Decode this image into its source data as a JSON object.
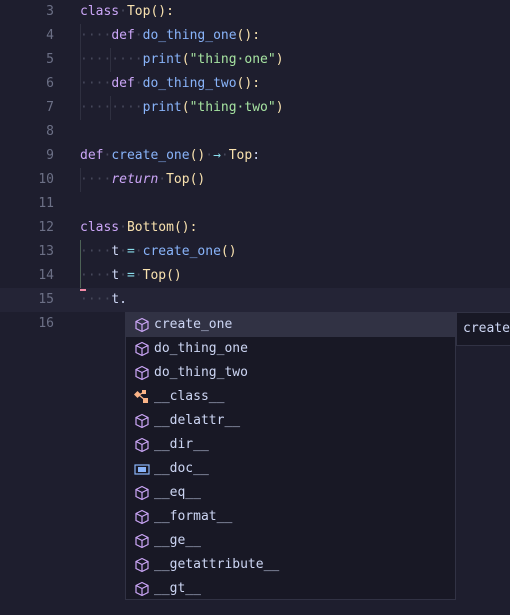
{
  "editor": {
    "lines": [
      {
        "num": "3",
        "tokens": [
          {
            "t": "class",
            "c": "kw"
          },
          {
            "t": "·",
            "c": "ws"
          },
          {
            "t": "Top",
            "c": "cls"
          },
          {
            "t": "():",
            "c": "p"
          }
        ]
      },
      {
        "num": "4",
        "tokens": [
          {
            "t": "····",
            "c": "ws"
          },
          {
            "t": "def",
            "c": "kw"
          },
          {
            "t": "·",
            "c": "ws"
          },
          {
            "t": "do_thing_one",
            "c": "fn"
          },
          {
            "t": "():",
            "c": "p"
          }
        ]
      },
      {
        "num": "5",
        "tokens": [
          {
            "t": "········",
            "c": "ws"
          },
          {
            "t": "print",
            "c": "fn"
          },
          {
            "t": "(",
            "c": "p"
          },
          {
            "t": "\"thing·one\"",
            "c": "str"
          },
          {
            "t": ")",
            "c": "p"
          }
        ]
      },
      {
        "num": "6",
        "tokens": [
          {
            "t": "····",
            "c": "ws"
          },
          {
            "t": "def",
            "c": "kw"
          },
          {
            "t": "·",
            "c": "ws"
          },
          {
            "t": "do_thing_two",
            "c": "fn"
          },
          {
            "t": "():",
            "c": "p"
          }
        ]
      },
      {
        "num": "7",
        "tokens": [
          {
            "t": "········",
            "c": "ws"
          },
          {
            "t": "print",
            "c": "fn"
          },
          {
            "t": "(",
            "c": "p"
          },
          {
            "t": "\"thing·two\"",
            "c": "str"
          },
          {
            "t": ")",
            "c": "p"
          }
        ]
      },
      {
        "num": "8",
        "tokens": []
      },
      {
        "num": "9",
        "tokens": [
          {
            "t": "def",
            "c": "kw"
          },
          {
            "t": "·",
            "c": "ws"
          },
          {
            "t": "create_one",
            "c": "fn"
          },
          {
            "t": "()",
            "c": "p"
          },
          {
            "t": "·",
            "c": "ws"
          },
          {
            "t": "→",
            "c": "op"
          },
          {
            "t": "·",
            "c": "ws"
          },
          {
            "t": "Top",
            "c": "ty"
          },
          {
            "t": ":",
            "c": "txt"
          }
        ]
      },
      {
        "num": "10",
        "tokens": [
          {
            "t": "····",
            "c": "ws"
          },
          {
            "t": "return",
            "c": "ret"
          },
          {
            "t": "·",
            "c": "ws"
          },
          {
            "t": "Top",
            "c": "ty"
          },
          {
            "t": "()",
            "c": "p"
          }
        ]
      },
      {
        "num": "11",
        "tokens": []
      },
      {
        "num": "12",
        "tokens": [
          {
            "t": "class",
            "c": "kw"
          },
          {
            "t": "·",
            "c": "ws"
          },
          {
            "t": "Bottom",
            "c": "cls"
          },
          {
            "t": "():",
            "c": "p"
          }
        ]
      },
      {
        "num": "13",
        "tokens": [
          {
            "t": "····",
            "c": "ws"
          },
          {
            "t": "t",
            "c": "txt"
          },
          {
            "t": "·",
            "c": "ws"
          },
          {
            "t": "=",
            "c": "op"
          },
          {
            "t": "·",
            "c": "ws"
          },
          {
            "t": "create_one",
            "c": "fn"
          },
          {
            "t": "()",
            "c": "p"
          }
        ]
      },
      {
        "num": "14",
        "tokens": [
          {
            "t": "····",
            "c": "ws"
          },
          {
            "t": "t",
            "c": "txt"
          },
          {
            "t": "·",
            "c": "ws"
          },
          {
            "t": "=",
            "c": "op"
          },
          {
            "t": "·",
            "c": "ws"
          },
          {
            "t": "Top",
            "c": "ty"
          },
          {
            "t": "()",
            "c": "p"
          }
        ]
      },
      {
        "num": "15",
        "tokens": [
          {
            "t": "····",
            "c": "ws"
          },
          {
            "t": "t.",
            "c": "txt"
          }
        ]
      },
      {
        "num": "16",
        "tokens": []
      }
    ]
  },
  "suggest": {
    "items": [
      {
        "label": "create_one",
        "icon": "method-cube-icon"
      },
      {
        "label": "do_thing_one",
        "icon": "method-cube-icon"
      },
      {
        "label": "do_thing_two",
        "icon": "method-cube-icon"
      },
      {
        "label": "__class__",
        "icon": "class-icon"
      },
      {
        "label": "__delattr__",
        "icon": "method-cube-icon"
      },
      {
        "label": "__dir__",
        "icon": "method-cube-icon"
      },
      {
        "label": "__doc__",
        "icon": "variable-icon"
      },
      {
        "label": "__eq__",
        "icon": "method-cube-icon"
      },
      {
        "label": "__format__",
        "icon": "method-cube-icon"
      },
      {
        "label": "__ge__",
        "icon": "method-cube-icon"
      },
      {
        "label": "__getattribute__",
        "icon": "method-cube-icon"
      },
      {
        "label": "__gt__",
        "icon": "method-cube-icon"
      }
    ],
    "selected_index": 0,
    "detail_text": "create_one"
  },
  "colors": {
    "background": "#1e1e2e",
    "accent": "#cba6f7",
    "icon_method": "#cba6f7",
    "icon_class": "#fab387",
    "icon_variable": "#89b4fa"
  }
}
